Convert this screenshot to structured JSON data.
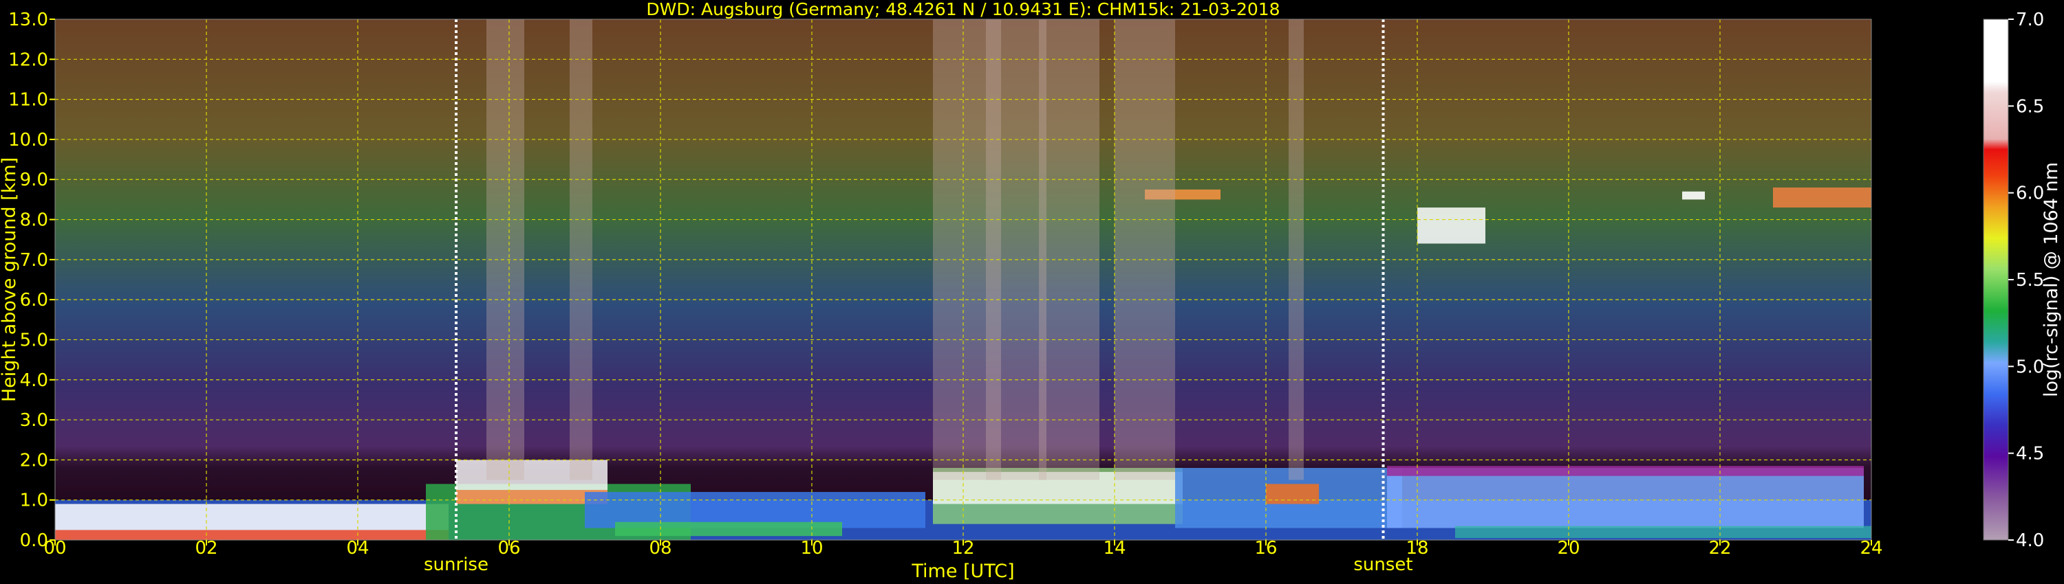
{
  "chart_data": {
    "type": "heatmap",
    "title": "DWD: Augsburg (Germany; 48.4261 N / 10.9431 E):    CHM15k: 21-03-2018",
    "xlabel": "Time [UTC]",
    "ylabel": "Height above ground [km]",
    "xlim": [
      0,
      24
    ],
    "ylim": [
      0,
      13
    ],
    "x_ticks": [
      "00",
      "02",
      "04",
      "06",
      "08",
      "10",
      "12",
      "14",
      "16",
      "18",
      "20",
      "22",
      "24"
    ],
    "y_ticks": [
      "0.0",
      "1.0",
      "2.0",
      "3.0",
      "4.0",
      "5.0",
      "6.0",
      "7.0",
      "8.0",
      "9.0",
      "10.0",
      "11.0",
      "12.0",
      "13.0"
    ],
    "grid": true,
    "markers": [
      {
        "label": "sunrise",
        "time": 5.3
      },
      {
        "label": "sunset",
        "time": 17.55
      }
    ],
    "colorbar": {
      "label": "log(rc-signal) @ 1064 nm",
      "range": [
        4.0,
        7.0
      ],
      "ticks": [
        "4.0",
        "4.5",
        "5.0",
        "5.5",
        "6.0",
        "6.5",
        "7.0"
      ]
    },
    "colors": {
      "text": "#ffff00",
      "background": "#000000",
      "grid": "#d8d800",
      "marker": "#ffffff"
    }
  }
}
